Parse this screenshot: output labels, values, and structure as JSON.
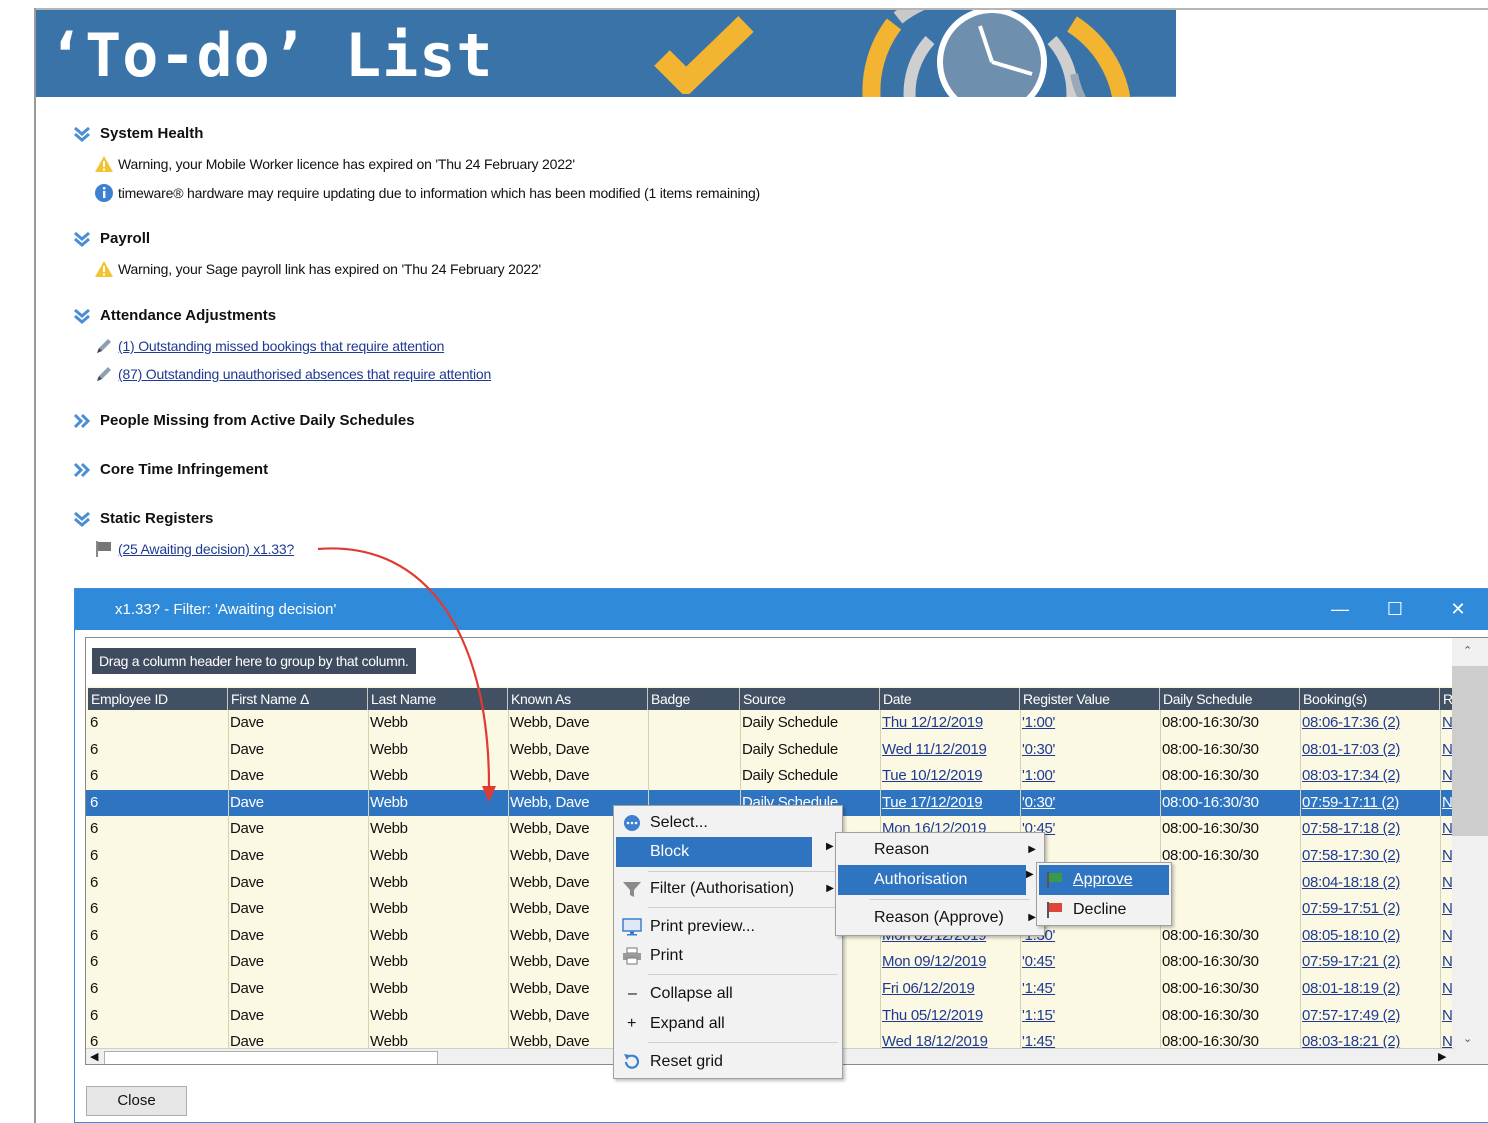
{
  "banner": {
    "title": "‘To-do’ List"
  },
  "sections": {
    "system_health": {
      "title": "System Health",
      "items": [
        "Warning, your Mobile Worker licence has expired on 'Thu 24 February 2022'",
        "timeware® hardware may require updating due to information which has been modified (1 items remaining)"
      ]
    },
    "payroll": {
      "title": "Payroll",
      "items": [
        "Warning, your Sage payroll link has expired on 'Thu 24 February 2022'"
      ]
    },
    "attendance": {
      "title": "Attendance Adjustments",
      "items": [
        "(1) Outstanding missed bookings that require attention",
        "(87) Outstanding unauthorised absences that require attention"
      ]
    },
    "people_missing": {
      "title": "People Missing from Active Daily Schedules"
    },
    "core_time": {
      "title": "Core Time Infringement"
    },
    "static_registers": {
      "title": "Static Registers",
      "items": [
        "(25 Awaiting decision) x1.33?"
      ]
    }
  },
  "dialog": {
    "title": "x1.33? - Filter: 'Awaiting decision'",
    "group_hint": "Drag a column header here to group by that column.",
    "close_label": "Close",
    "columns": [
      "Employee ID",
      "First Name Δ",
      "Last Name",
      "Known As",
      "Badge",
      "Source",
      "Date",
      "Register Value",
      "Daily Schedule",
      "Booking(s)",
      "R"
    ],
    "rows": [
      [
        "6",
        "Dave",
        "Webb",
        "Webb, Dave",
        "",
        "Daily Schedule",
        "Thu 12/12/2019",
        "'1:00'",
        "08:00-16:30/30",
        "08:06-17:36 (2)",
        "N"
      ],
      [
        "6",
        "Dave",
        "Webb",
        "Webb, Dave",
        "",
        "Daily Schedule",
        "Wed 11/12/2019",
        "'0:30'",
        "08:00-16:30/30",
        "08:01-17:03 (2)",
        "N"
      ],
      [
        "6",
        "Dave",
        "Webb",
        "Webb, Dave",
        "",
        "Daily Schedule",
        "Tue 10/12/2019",
        "'1:00'",
        "08:00-16:30/30",
        "08:03-17:34 (2)",
        "N"
      ],
      [
        "6",
        "Dave",
        "Webb",
        "Webb, Dave",
        "",
        "Daily Schedule",
        "Tue 17/12/2019",
        "'0:30'",
        "08:00-16:30/30",
        "07:59-17:11 (2)",
        "N"
      ],
      [
        "6",
        "Dave",
        "Webb",
        "Webb, Dave",
        "",
        "",
        "Mon 16/12/2019",
        "'0:45'",
        "08:00-16:30/30",
        "07:58-17:18 (2)",
        "N"
      ],
      [
        "6",
        "Dave",
        "Webb",
        "Webb, Dave",
        "",
        "",
        "",
        "",
        "08:00-16:30/30",
        "07:58-17:30 (2)",
        "N"
      ],
      [
        "6",
        "Dave",
        "Webb",
        "Webb, Dave",
        "",
        "",
        "",
        "",
        "",
        "08:04-18:18 (2)",
        "N"
      ],
      [
        "6",
        "Dave",
        "Webb",
        "Webb, Dave",
        "",
        "",
        "",
        "",
        "",
        "07:59-17:51 (2)",
        "N"
      ],
      [
        "6",
        "Dave",
        "Webb",
        "Webb, Dave",
        "",
        "",
        "Mon 02/12/2019",
        "'1:30'",
        "08:00-16:30/30",
        "08:05-18:10 (2)",
        "N"
      ],
      [
        "6",
        "Dave",
        "Webb",
        "Webb, Dave",
        "",
        "",
        "Mon 09/12/2019",
        "'0:45'",
        "08:00-16:30/30",
        "07:59-17:21 (2)",
        "N"
      ],
      [
        "6",
        "Dave",
        "Webb",
        "Webb, Dave",
        "",
        "",
        "Fri 06/12/2019",
        "'1:45'",
        "08:00-16:30/30",
        "08:01-18:19 (2)",
        "N"
      ],
      [
        "6",
        "Dave",
        "Webb",
        "Webb, Dave",
        "",
        "",
        "Thu 05/12/2019",
        "'1:15'",
        "08:00-16:30/30",
        "07:57-17:49 (2)",
        "N"
      ],
      [
        "6",
        "Dave",
        "Webb",
        "Webb, Dave",
        "",
        "",
        "Wed 18/12/2019",
        "'1:45'",
        "08:00-16:30/30",
        "08:03-18:21 (2)",
        "N"
      ]
    ]
  },
  "context_menu": {
    "select": "Select...",
    "block": "Block",
    "filter": "Filter (Authorisation)",
    "print_preview": "Print preview...",
    "print": "Print",
    "collapse_all": "Collapse all",
    "expand_all": "Expand all",
    "reset_grid": "Reset grid"
  },
  "block_submenu": {
    "reason": "Reason",
    "authorisation": "Authorisation",
    "reason_approve": "Reason (Approve)"
  },
  "auth_submenu": {
    "approve": "Approve",
    "decline": "Decline"
  },
  "colors": {
    "banner_blue": "#3a73a8",
    "title_bar_blue": "#2f8ad9",
    "selection_blue": "#2f74c0",
    "header_dark": "#415063",
    "grid_background": "#fbf9e3",
    "arrow_red": "#e03a32",
    "check_gold": "#f2b431"
  },
  "icons": [
    "checkmark-icon",
    "clock-icon",
    "chevron-down-icon",
    "chevron-right-icon",
    "warning-icon",
    "info-icon",
    "pencil-icon",
    "flag-icon",
    "select-icon",
    "filter-icon",
    "print-preview-icon",
    "print-icon",
    "reset-icon",
    "approve-flag-icon",
    "decline-flag-icon"
  ]
}
